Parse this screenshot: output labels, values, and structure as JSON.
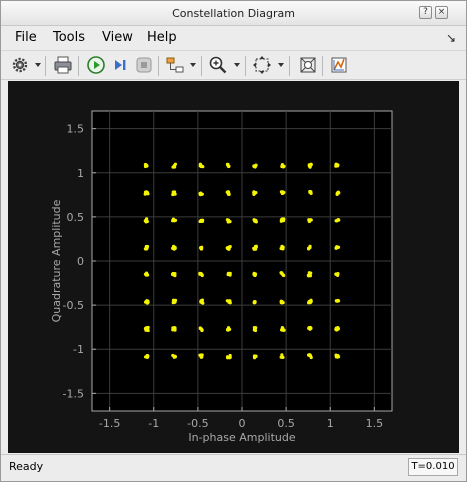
{
  "window": {
    "title": "Constellation Diagram",
    "buttons": [
      "?",
      "×"
    ]
  },
  "menu": {
    "items": [
      {
        "label": "File"
      },
      {
        "label": "Tools"
      },
      {
        "label": "View"
      },
      {
        "label": "Help"
      }
    ],
    "dock_icon": "undock-arrow-icon"
  },
  "toolbar": {
    "tools": [
      {
        "name": "settings-gear-icon",
        "has_menu": true
      },
      {
        "name": "print-icon",
        "has_menu": false
      },
      {
        "name": "run-icon",
        "has_menu": false,
        "color": "#2e9b2e"
      },
      {
        "name": "step-forward-icon",
        "has_menu": false,
        "color": "#3b6fc7"
      },
      {
        "name": "stop-icon",
        "has_menu": false,
        "color": "#9a9a9a"
      },
      {
        "name": "highlight-simulink-block-icon",
        "has_menu": true
      },
      {
        "name": "zoom-in-icon",
        "has_menu": true
      },
      {
        "name": "autoscale-icon",
        "has_menu": true
      },
      {
        "name": "axes-scaling-icon",
        "has_menu": false
      },
      {
        "name": "measurements-icon",
        "has_menu": false
      }
    ]
  },
  "chart_data": {
    "type": "scatter",
    "title": "",
    "xlabel": "In-phase Amplitude",
    "ylabel": "Quadrature Amplitude",
    "xlim": [
      -1.7,
      1.7
    ],
    "ylim": [
      -1.7,
      1.7
    ],
    "xticks": [
      -1.5,
      -1,
      -0.5,
      0,
      0.5,
      1,
      1.5
    ],
    "yticks": [
      1.5,
      1,
      0.5,
      0,
      -0.5,
      -1,
      -1.5
    ],
    "grid": true,
    "marker_color": "#f5f500",
    "axes_background": "#000000",
    "figure_background": "#141414",
    "axis_text_color": "#a8a8a8",
    "points": {
      "i_levels": [
        -1.08,
        -0.77,
        -0.46,
        -0.15,
        0.15,
        0.46,
        0.77,
        1.08
      ],
      "q_levels": [
        1.08,
        0.77,
        0.46,
        0.15,
        -0.15,
        -0.46,
        -0.77,
        -1.08
      ]
    }
  },
  "status": {
    "text": "Ready",
    "time": "T=0.010"
  }
}
